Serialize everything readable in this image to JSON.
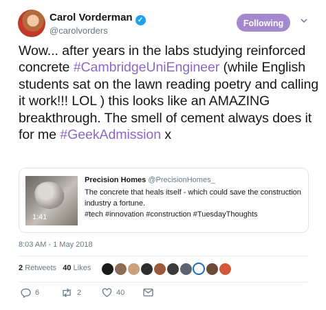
{
  "author": {
    "name": "Carol Vorderman",
    "handle": "@carolvorders",
    "verified_icon": "verified-badge-icon"
  },
  "follow_button": {
    "label": "Following",
    "color": "#a489cf"
  },
  "menu_icon": "chevron-down-icon",
  "tweet": {
    "parts": [
      {
        "text": "Wow... after years in the labs studying reinforced concrete ",
        "tag": false
      },
      {
        "text": "#CambridgeUniEngineer",
        "tag": true
      },
      {
        "text": " (while English students sat on the lawn reading poetry and calling it work!!! LOL ) this looks like an AMAZING breakthrough. The smell of cement always does it for me ",
        "tag": false
      },
      {
        "text": "#GeekAdmission",
        "tag": true
      },
      {
        "text": " x",
        "tag": false
      }
    ],
    "hashtag_color": "#8c68c4"
  },
  "quoted": {
    "name": "Precision Homes",
    "handle": "@PrecisionHomes_",
    "text": "The concrete that heals itself - which could save the construction industry a fortune.",
    "tags": "#tech #innovation  #construction #TuesdayThoughts",
    "video_duration": "1:41"
  },
  "timestamp": "8:03 AM - 1 May 2018",
  "stats": {
    "retweets_count": "2",
    "retweets_label": "Retweets",
    "likes_count": "40",
    "likes_label": "Likes"
  },
  "likers": [
    "avatar",
    "avatar",
    "avatar",
    "avatar",
    "avatar",
    "avatar",
    "avatar",
    "avatar",
    "avatar",
    "avatar"
  ],
  "actions": {
    "reply_count": "6",
    "retweet_count": "2",
    "like_count": "40"
  }
}
